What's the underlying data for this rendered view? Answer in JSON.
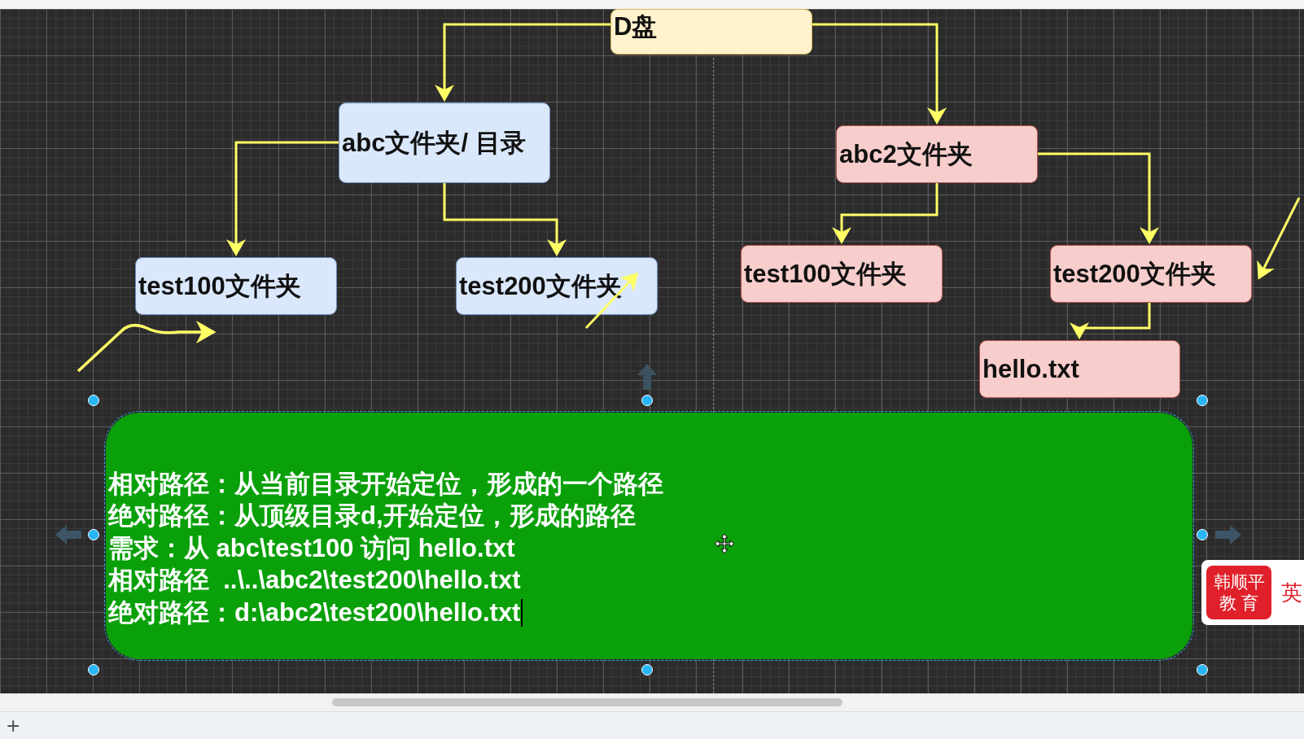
{
  "canvas": {
    "nodes": [
      {
        "label": "D盘",
        "color": "#fff2cc"
      },
      {
        "label": "abc文件夹/ 目录",
        "color": "#dae8fc"
      },
      {
        "label": "test100文件夹",
        "color": "#dae8fc"
      },
      {
        "label": "test200文件夹",
        "color": "#dae8fc"
      },
      {
        "label": "abc2文件夹",
        "color": "#f8cecc"
      },
      {
        "label": "test100文件夹",
        "color": "#f8cecc"
      },
      {
        "label": "test200文件夹",
        "color": "#f8cecc"
      },
      {
        "label": "hello.txt",
        "color": "#f8cecc"
      }
    ],
    "note": {
      "selected": true,
      "lines": [
        "相对路径：从当前目录开始定位，形成的一个路径",
        "绝对路径：从顶级目录d,开始定位，形成的路径",
        "需求：从 abc\\test100 访问 hello.txt",
        "相对路径  ..\\..\\abc2\\test200\\hello.txt",
        "绝对路径：d:\\abc2\\test200\\hello.txt"
      ]
    }
  },
  "badge": {
    "lines": [
      "韩顺平",
      "教 育"
    ],
    "side_text": "英"
  },
  "bottom_bar": {
    "add_button": "+"
  }
}
